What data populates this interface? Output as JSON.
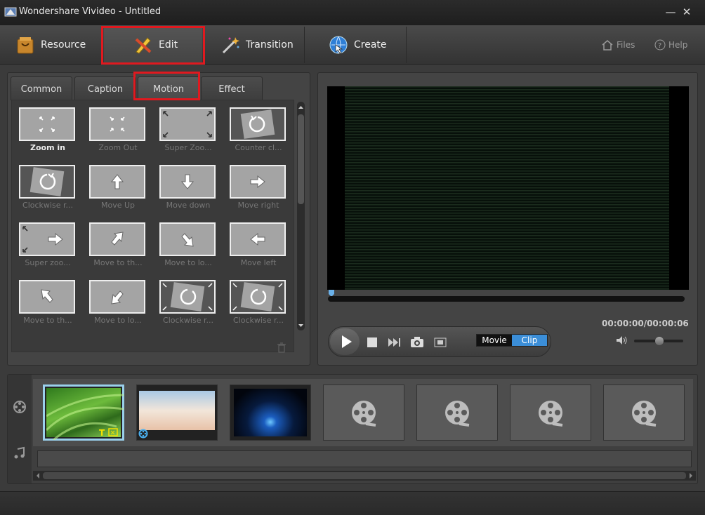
{
  "window": {
    "title": "Wondershare Vivideo - Untitled",
    "minimize_glyph": "—",
    "close_glyph": "✕"
  },
  "toolbar": {
    "tabs": [
      {
        "label": "Resource",
        "icon": "shopping-bag-icon"
      },
      {
        "label": "Edit",
        "icon": "pencil-ruler-icon"
      },
      {
        "label": "Transition",
        "icon": "magic-wand-icon"
      },
      {
        "label": "Create",
        "icon": "globe-icon"
      }
    ],
    "files_label": "Files",
    "help_label": "Help"
  },
  "subtabs": [
    "Common",
    "Caption",
    "Motion",
    "Effect"
  ],
  "motion_effects": [
    "Zoom in",
    "Zoom Out",
    "Super Zoo...",
    "Counter cl...",
    "Clockwise r...",
    "Move Up",
    "Move down",
    "Move right",
    "Super zoo...",
    "Move to th...",
    "Move to lo...",
    "Move left",
    "Move to th...",
    "Move to lo...",
    "Clockwise r...",
    "Clockwise r..."
  ],
  "preview": {
    "timecode": "00:00:00/00:00:06",
    "mode_movie": "Movie",
    "mode_clip": "Clip"
  },
  "colors": {
    "highlight_box": "#e0191f",
    "clip_mode": "#3b8ed8",
    "selected_clip": "#9ad0ec"
  }
}
